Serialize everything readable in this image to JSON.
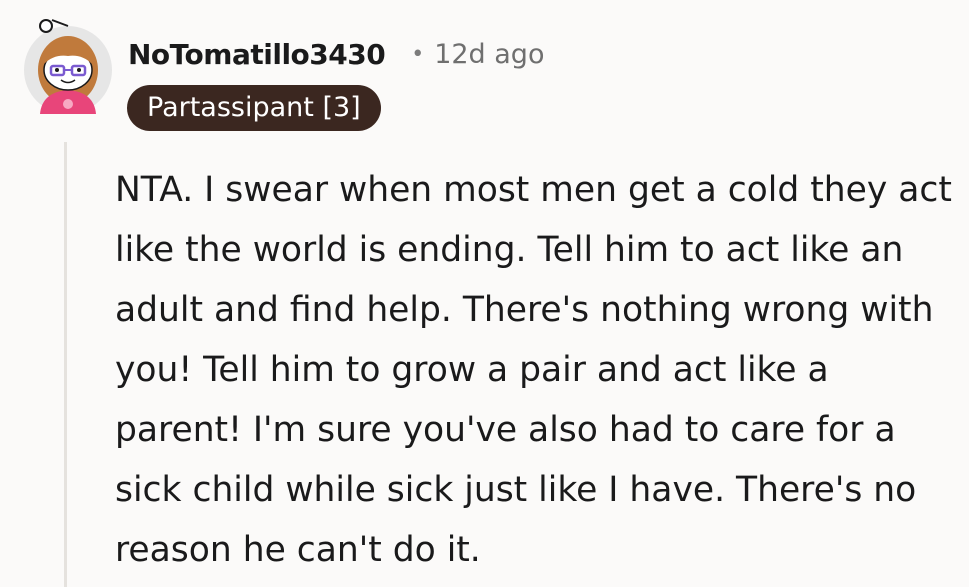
{
  "comment": {
    "username": "NoTomatillo3430",
    "separator": "•",
    "timestamp": "12d ago",
    "flair": "Partassipant [3]",
    "body": "NTA. I swear when most men get a cold they act like the world is ending. Tell him to act like an adult and find help. There's nothing wrong with you! Tell him to grow a pair and act like a parent! I'm sure you've also had to care for a sick child while sick just like I have. There's no reason he can't do it."
  },
  "avatar": {
    "icon": "snoo-avatar-icon",
    "colors": {
      "hair": "#c07a3c",
      "shirt": "#e8457a",
      "glasses": "#7a5ad0",
      "background": "#e6e6e6"
    }
  }
}
